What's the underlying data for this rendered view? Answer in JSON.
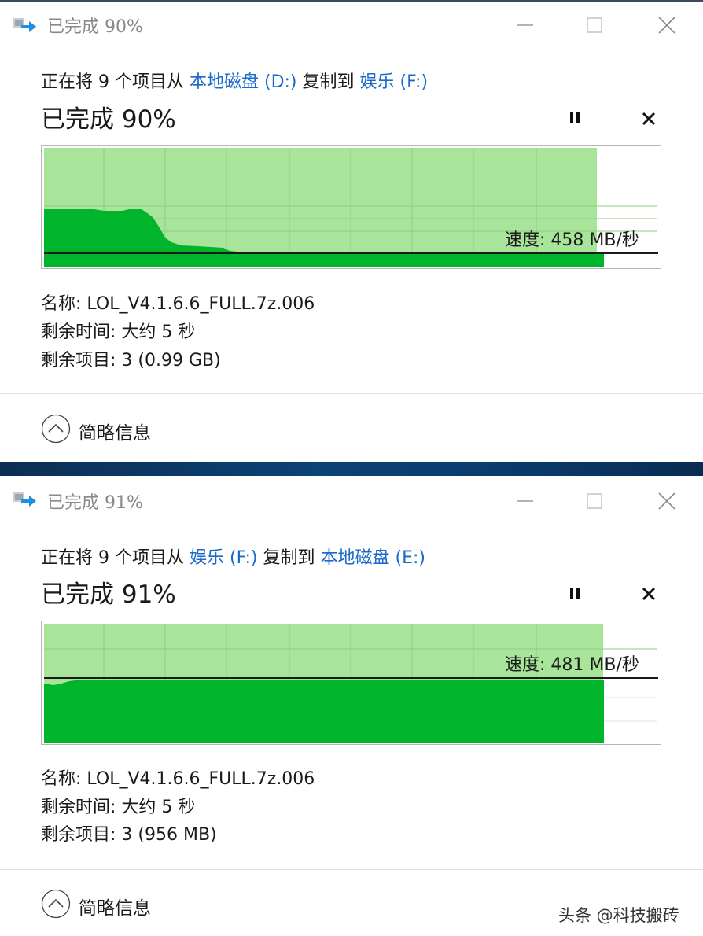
{
  "dialogs": [
    {
      "window_title": "已完成 90%",
      "desc_prefix": "正在将 9 个项目从 ",
      "source_name": "本地磁盘",
      "source_drive": " (D:)",
      "desc_middle": " 复制到 ",
      "dest_name": "娱乐",
      "dest_drive": " (F:)",
      "progress_text": "已完成 90%",
      "progress": 0.9,
      "speed_text": "速度: 458 MB/秒",
      "name_row": "名称: LOL_V4.1.6.6_FULL.7z.006",
      "time_row": "剩余时间: 大约 5 秒",
      "items_row": "剩余项目: 3 (0.99 GB)",
      "collapse_label": "简略信息"
    },
    {
      "window_title": "已完成 91%",
      "desc_prefix": "正在将 9 个项目从 ",
      "source_name": "娱乐",
      "source_drive": " (F:)",
      "desc_middle": " 复制到 ",
      "dest_name": "本地磁盘",
      "dest_drive": " (E:)",
      "progress_text": "已完成 91%",
      "progress": 0.91,
      "speed_text": "速度: 481 MB/秒",
      "name_row": "名称: LOL_V4.1.6.6_FULL.7z.006",
      "time_row": "剩余时间: 大约 5 秒",
      "items_row": "剩余项目: 3 (956 MB)",
      "collapse_label": "简略信息"
    }
  ],
  "watermark": "头条 @科技搬砖",
  "colors": {
    "graph_light": "#a8e49a",
    "graph_dark": "#00b42c",
    "graph_border": "#b5b5b5",
    "link": "#1b6ac9",
    "title_gray": "#8a8a8a"
  },
  "icons": [
    "copy-arrow-icon",
    "minimize-icon",
    "maximize-icon",
    "close-icon",
    "pause-icon",
    "cancel-icon",
    "chevron-up-icon"
  ]
}
